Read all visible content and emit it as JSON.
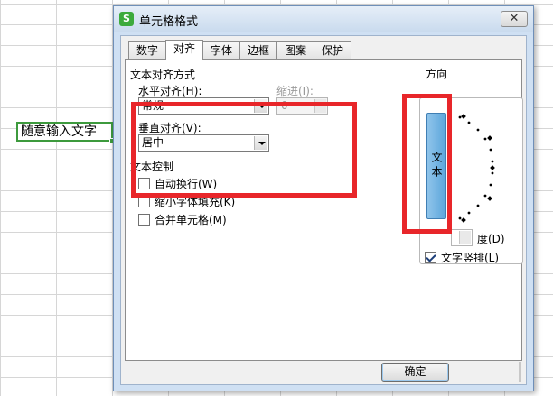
{
  "sheet": {
    "active_cell_text": "随意输入文字"
  },
  "dialog": {
    "title": "单元格格式",
    "app_icon": "S",
    "close_glyph": "✕",
    "tabs": [
      "数字",
      "对齐",
      "字体",
      "边框",
      "图案",
      "保护"
    ],
    "active_tab": "对齐"
  },
  "alignment": {
    "group_label": "文本对齐方式",
    "horizontal_label": "水平对齐(H):",
    "horizontal_value": "常规",
    "indent_label": "缩进(I):",
    "indent_value": "0",
    "vertical_label": "垂直对齐(V):",
    "vertical_value": "居中"
  },
  "text_control": {
    "group_label": "文本控制",
    "wrap": {
      "label": "自动换行(W)",
      "checked": false
    },
    "shrink": {
      "label": "缩小字体填充(K)",
      "checked": false
    },
    "merge": {
      "label": "合并单元格(M)",
      "checked": false
    }
  },
  "orientation": {
    "group_label": "方向",
    "vertical_button_text": "文本",
    "degree_label": "度(D)",
    "stack_checkbox": {
      "label": "文字竖排(L)",
      "checked": true
    }
  },
  "buttons": {
    "ok": "确定"
  },
  "colors": {
    "highlight_red": "#e8262a",
    "active_cell_green": "#3d9a3d",
    "selected_orientation_blue": "#5ca6dc"
  }
}
